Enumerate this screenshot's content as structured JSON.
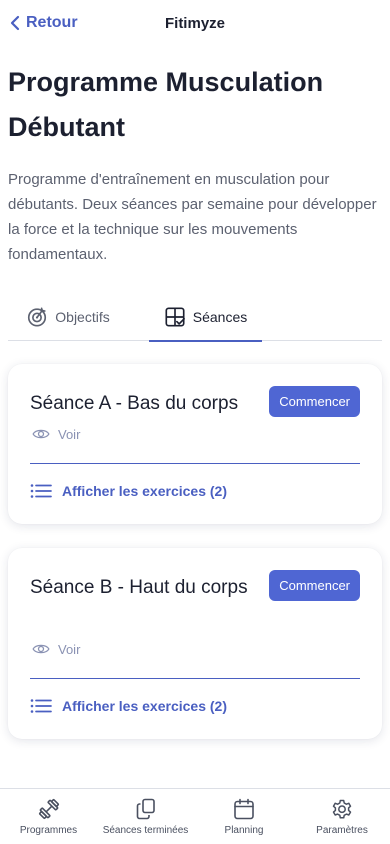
{
  "header": {
    "back_label": "Retour",
    "app_title": "Fitimyze"
  },
  "program": {
    "title": "Programme Musculation Débutant",
    "description": "Programme d'entraînement en musculation pour débutants. Deux séances par semaine pour développer la force et la technique sur les mouvements fondamentaux."
  },
  "tabs": [
    {
      "label": "Objectifs",
      "icon": "target-icon",
      "active": false
    },
    {
      "label": "Séances",
      "icon": "grid-check-icon",
      "active": true
    }
  ],
  "sessions": [
    {
      "title": "Séance A - Bas du corps",
      "start_label": "Commencer",
      "view_label": "Voir",
      "exercises_label": "Afficher les exercices (2)"
    },
    {
      "title": "Séance B - Haut du corps",
      "start_label": "Commencer",
      "view_label": "Voir",
      "exercises_label": "Afficher les exercices (2)"
    }
  ],
  "bottom_nav": [
    {
      "label": "Programmes",
      "icon": "dumbbell-icon"
    },
    {
      "label": "Séances terminées",
      "icon": "copy-icon"
    },
    {
      "label": "Planning",
      "icon": "calendar-icon"
    },
    {
      "label": "Paramètres",
      "icon": "gear-icon"
    }
  ],
  "colors": {
    "accent": "#4a5fc1",
    "button": "#4f66d3",
    "text": "#1c2030",
    "muted": "#5c6170"
  }
}
